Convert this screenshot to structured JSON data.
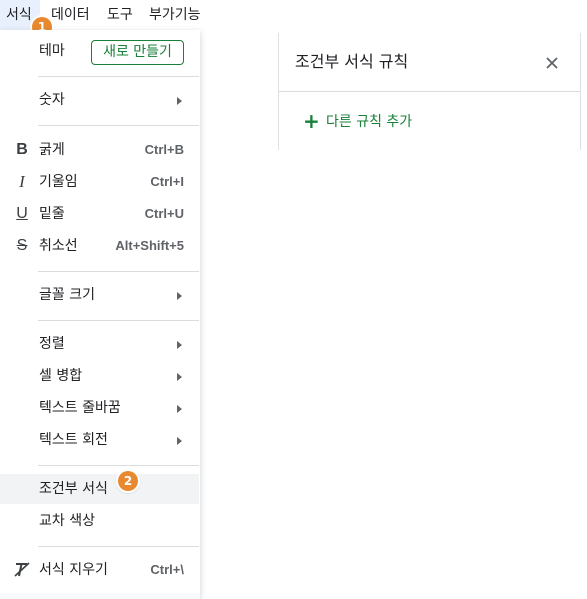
{
  "menubar": {
    "items": [
      {
        "label": "서식"
      },
      {
        "label": "데이터"
      },
      {
        "label": "도구"
      },
      {
        "label": "부가기능"
      }
    ]
  },
  "badges": {
    "one": "1",
    "two": "2"
  },
  "format_menu": {
    "theme_label": "테마",
    "theme_button": "새로 만들기",
    "number_label": "숫자",
    "bold_label": "굵게",
    "bold_shortcut": "Ctrl+B",
    "italic_label": "기울임",
    "italic_shortcut": "Ctrl+I",
    "underline_label": "밑줄",
    "underline_shortcut": "Ctrl+U",
    "strike_label": "취소선",
    "strike_shortcut": "Alt+Shift+5",
    "fontsize_label": "글꼴 크기",
    "align_label": "정렬",
    "merge_label": "셀 병합",
    "wrap_label": "텍스트 줄바꿈",
    "rotate_label": "텍스트 회전",
    "conditional_label": "조건부 서식",
    "alternating_label": "교차 색상",
    "clear_label": "서식 지우기",
    "clear_shortcut": "Ctrl+\\"
  },
  "panel": {
    "title": "조건부 서식 규칙",
    "add_rule": "다른 규칙 추가"
  },
  "colors": {
    "accent_green": "#188038",
    "badge_orange": "#e8892f",
    "highlight": "#f1f3f4"
  },
  "icons": {
    "bold": "bold-icon",
    "italic": "italic-icon",
    "underline": "underline-icon",
    "strike": "strikethrough-icon",
    "clear": "clear-format-icon",
    "close": "close-icon",
    "add": "plus-icon"
  }
}
